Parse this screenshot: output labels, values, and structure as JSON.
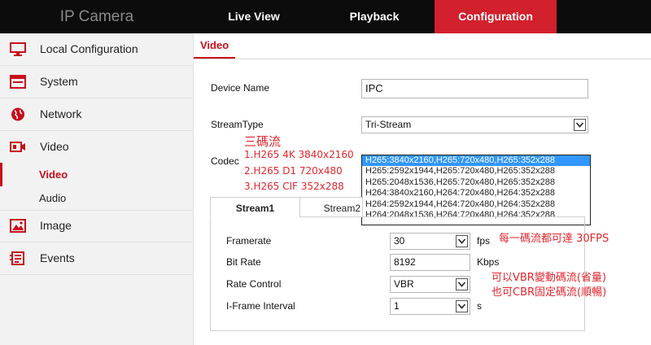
{
  "app_title": "IP Camera",
  "nav": [
    {
      "label": "Live View"
    },
    {
      "label": "Playback"
    },
    {
      "label": "Configuration"
    }
  ],
  "sidebar": {
    "items": [
      {
        "label": "Local Configuration",
        "icon": "monitor-icon"
      },
      {
        "label": "System",
        "icon": "system-icon"
      },
      {
        "label": "Network",
        "icon": "globe-icon"
      },
      {
        "label": "Video",
        "icon": "video-camera-icon"
      },
      {
        "label": "Image",
        "icon": "image-icon"
      },
      {
        "label": "Events",
        "icon": "events-icon"
      }
    ],
    "subitems": [
      {
        "label": "Video"
      },
      {
        "label": "Audio"
      }
    ]
  },
  "page": {
    "tab": "Video",
    "device_name_label": "Device Name",
    "device_name_value": "IPC",
    "stream_type_label": "StreamType",
    "stream_type_value": "Tri-Stream",
    "codec_label": "Codec",
    "codec_options": [
      "H265:3840x2160,H265:720x480,H265:352x288",
      "H265:2592x1944,H265:720x480,H265:352x288",
      "H265:2048x1536,H265:720x480,H265:352x288",
      "H264:3840x2160,H264:720x480,H264:352x288",
      "H264:2592x1944,H264:720x480,H264:352x288",
      "H264:2048x1536,H264:720x480,H264:352x288"
    ],
    "stream_tabs": [
      "Stream1",
      "Stream2"
    ],
    "framerate_label": "Framerate",
    "framerate_value": "30",
    "framerate_unit": "fps",
    "bitrate_label": "Bit Rate",
    "bitrate_value": "8192",
    "bitrate_unit": "Kbps",
    "rate_control_label": "Rate Control",
    "rate_control_value": "VBR",
    "iframe_label": "I-Frame Interval",
    "iframe_value": "1",
    "iframe_unit": "s"
  },
  "annotations": {
    "streams_title": "三碼流",
    "stream_lines": [
      "1.H265 4K 3840x2160",
      "2.H265 D1 720x480",
      "3.H265 CIF 352x288"
    ],
    "fps_note": "每一碼流都可達 30FPS",
    "vbr_note": "可以VBR變動碼流(省量)",
    "cbr_note": "也可CBR固定碼流(順暢)"
  },
  "colors": {
    "accent": "#d2202d",
    "topbar": "#0c0c0c",
    "selection": "#3297fd",
    "annotation": "#e0262e"
  }
}
